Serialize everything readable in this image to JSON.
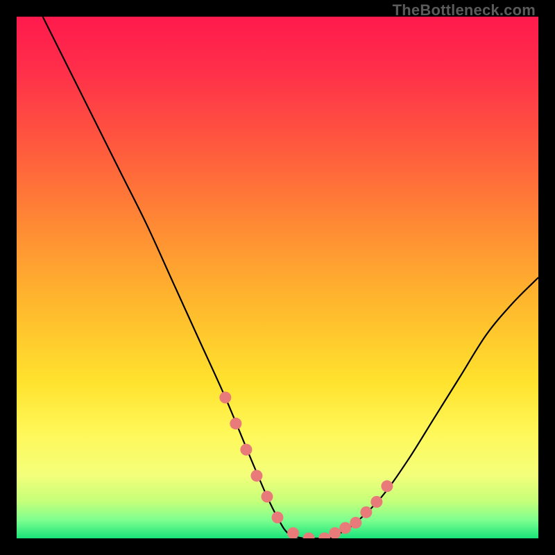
{
  "watermark": {
    "text": "TheBottleneck.com"
  },
  "colors": {
    "background": "#000000",
    "gradient_stops": [
      {
        "offset": 0.0,
        "color": "#ff1a4d"
      },
      {
        "offset": 0.1,
        "color": "#ff2e4a"
      },
      {
        "offset": 0.25,
        "color": "#ff5a3e"
      },
      {
        "offset": 0.4,
        "color": "#ff8a34"
      },
      {
        "offset": 0.55,
        "color": "#ffb82d"
      },
      {
        "offset": 0.7,
        "color": "#ffe22d"
      },
      {
        "offset": 0.8,
        "color": "#fff85a"
      },
      {
        "offset": 0.88,
        "color": "#f3ff7a"
      },
      {
        "offset": 0.93,
        "color": "#c4ff7a"
      },
      {
        "offset": 0.965,
        "color": "#7dff8f"
      },
      {
        "offset": 1.0,
        "color": "#19e37a"
      }
    ],
    "curve": "#000000",
    "marker_fill": "#e97a7a",
    "marker_stroke": "#d66a6a"
  },
  "chart_data": {
    "type": "line",
    "title": "",
    "xlabel": "",
    "ylabel": "",
    "xlim": [
      0,
      100
    ],
    "ylim": [
      0,
      100
    ],
    "grid": false,
    "legend": false,
    "series": [
      {
        "name": "bottleneck-curve",
        "x": [
          5,
          10,
          15,
          20,
          25,
          30,
          35,
          40,
          45,
          48,
          50,
          52,
          55,
          58,
          60,
          62,
          65,
          70,
          75,
          80,
          85,
          90,
          95,
          100
        ],
        "y": [
          100,
          90,
          80,
          70,
          60,
          49,
          38,
          27,
          15,
          8,
          4,
          1,
          0,
          0,
          0,
          1,
          3,
          8,
          15,
          23,
          31,
          39,
          45,
          50
        ]
      }
    ],
    "markers": {
      "name": "highlight-dots",
      "x": [
        40,
        42,
        44,
        46,
        48,
        50,
        53,
        56,
        59,
        61,
        63,
        65,
        67,
        69,
        71
      ],
      "y": [
        27,
        22,
        17,
        12,
        8,
        4,
        1,
        0,
        0,
        1,
        2,
        3,
        5,
        7,
        10
      ]
    }
  }
}
